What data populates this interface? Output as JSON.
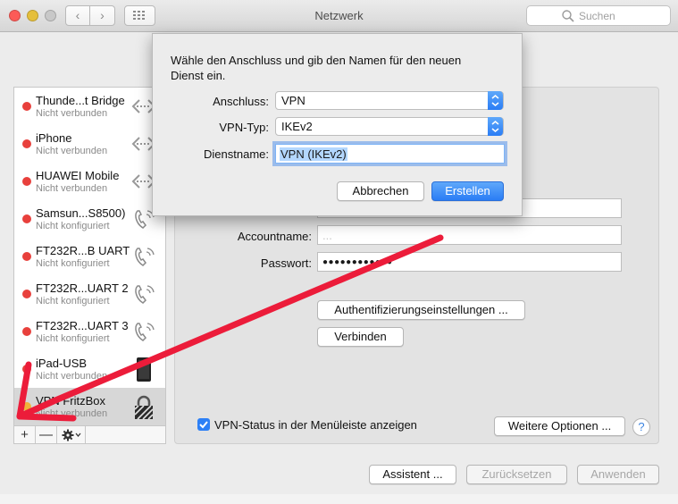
{
  "window": {
    "title": "Netzwerk"
  },
  "search": {
    "placeholder": "Suchen"
  },
  "services": [
    {
      "name": "Thunde...t Bridge",
      "status": "Nicht verbunden",
      "dot": "#e8403c",
      "icon": "bridge-icon"
    },
    {
      "name": "iPhone",
      "status": "Nicht verbunden",
      "dot": "#e8403c",
      "icon": "bridge-icon"
    },
    {
      "name": "HUAWEI Mobile",
      "status": "Nicht verbunden",
      "dot": "#e8403c",
      "icon": "bridge-icon"
    },
    {
      "name": "Samsun...S8500)",
      "status": "Nicht konfiguriert",
      "dot": "#e8403c",
      "icon": "phone-icon"
    },
    {
      "name": "FT232R...B UART",
      "status": "Nicht konfiguriert",
      "dot": "#e8403c",
      "icon": "phone-icon"
    },
    {
      "name": "FT232R...UART 2",
      "status": "Nicht konfiguriert",
      "dot": "#e8403c",
      "icon": "phone-icon"
    },
    {
      "name": "FT232R...UART 3",
      "status": "Nicht konfiguriert",
      "dot": "#e8403c",
      "icon": "phone-icon"
    },
    {
      "name": "iPad-USB",
      "status": "Nicht verbunden",
      "dot": "#e8403c",
      "icon": "ipad-icon"
    },
    {
      "name": "VPN FritzBox",
      "status": "Nicht verbunden",
      "dot": "#f0b43a",
      "icon": "lock-icon"
    }
  ],
  "sidebar_toolbar": {
    "add": "+",
    "remove": "—"
  },
  "form": {
    "account_label": "Accountname:",
    "account_value": "...",
    "password_label": "Passwort:",
    "password_value": "●●●●●●●●●●●●",
    "auth_button": "Authentifizierungseinstellungen ...",
    "connect_button": "Verbinden",
    "vpn_status_label": "VPN-Status in der Menüleiste anzeigen",
    "advanced_button": "Weitere Optionen ...",
    "help": "?"
  },
  "footer": {
    "assistant": "Assistent ...",
    "reset": "Zurücksetzen",
    "apply": "Anwenden"
  },
  "sheet": {
    "message": "Wähle den Anschluss und gib den Namen für den neuen Dienst ein.",
    "interface_label": "Anschluss:",
    "interface_value": "VPN",
    "vpn_type_label": "VPN-Typ:",
    "vpn_type_value": "IKEv2",
    "service_name_label": "Dienstname:",
    "service_name_value": "VPN (IKEv2)",
    "cancel": "Abbrechen",
    "create": "Erstellen"
  },
  "colors": {
    "accent": "#2a7df5",
    "annotation_arrow": "#ec1c3a"
  }
}
